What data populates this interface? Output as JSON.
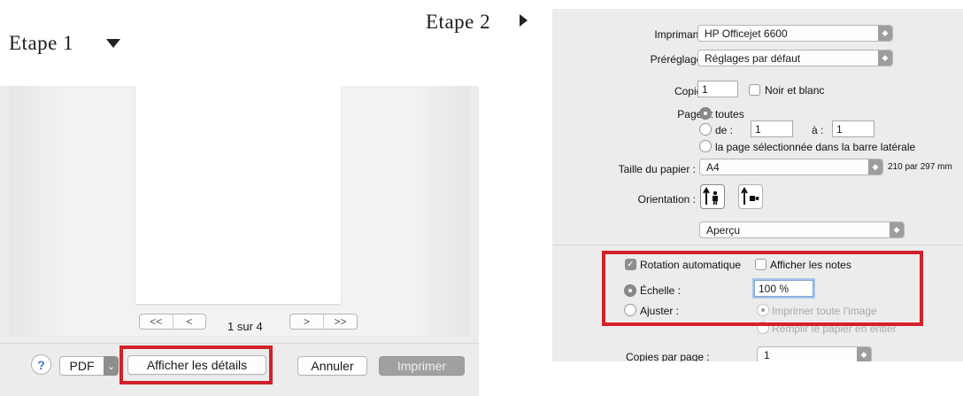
{
  "steps": {
    "step1": "Etape 1",
    "step2": "Etape 2"
  },
  "left_dialog": {
    "nav": {
      "first": "<<",
      "prev": "<",
      "next": ">",
      "last": ">>",
      "counter": "1 sur 4"
    },
    "help_label": "?",
    "pdf_label": "PDF",
    "pdf_arrow": "⌄",
    "show_details_label": "Afficher les détails",
    "cancel_label": "Annuler",
    "print_label": "Imprimer"
  },
  "right_dialog": {
    "printer": {
      "label": "Imprimante :",
      "value": "HP Officejet 6600"
    },
    "presets": {
      "label": "Préréglages :",
      "value": "Réglages par défaut"
    },
    "copies": {
      "label": "Copies :",
      "value": "1",
      "bw_label": "Noir et blanc"
    },
    "pages": {
      "label": "Pages :",
      "all_label": "toutes",
      "from_label": "de :",
      "from_value": "1",
      "to_label": "à :",
      "to_value": "1",
      "sidebar_label": "la page sélectionnée dans la barre latérale"
    },
    "paper": {
      "label": "Taille du papier :",
      "value": "A4",
      "size_text": "210 par 297 mm"
    },
    "orientation": {
      "label": "Orientation :"
    },
    "section_popup": "Aperçu",
    "auto_rotate_label": "Rotation automatique",
    "show_notes_label": "Afficher les notes",
    "scale": {
      "label": "Échelle :",
      "value": "100 %"
    },
    "fit": {
      "label": "Ajuster :",
      "print_entire": "Imprimer toute l’image",
      "fill_paper": "Remplir le papier en entier"
    },
    "copies_per_page": {
      "label": "Copies par page :",
      "value": "1"
    }
  },
  "colors": {
    "highlight_box": "#d3202a",
    "dialog_bg": "#ececec"
  }
}
